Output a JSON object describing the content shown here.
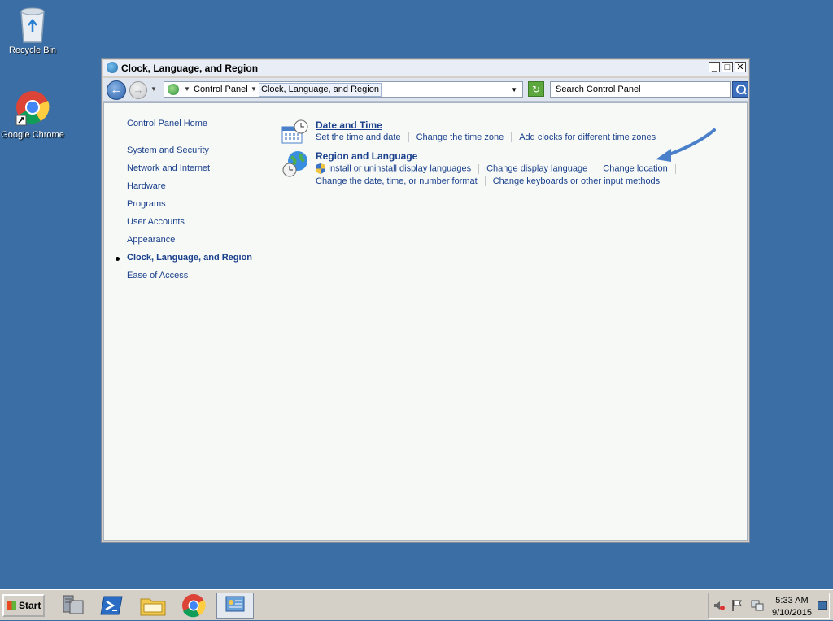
{
  "desktop": {
    "icons": [
      {
        "label": "Recycle Bin"
      },
      {
        "label": "Google Chrome"
      }
    ]
  },
  "window": {
    "title": "Clock, Language, and Region",
    "controls": {
      "minimize": "_",
      "maximize": "□",
      "close": "✕"
    },
    "address": {
      "crumbs": [
        "Control Panel",
        "Clock, Language, and Region"
      ]
    },
    "search": {
      "placeholder": "Search Control Panel"
    }
  },
  "left_nav": {
    "home": "Control Panel Home",
    "items": [
      "System and Security",
      "Network and Internet",
      "Hardware",
      "Programs",
      "User Accounts",
      "Appearance",
      "Clock, Language, and Region",
      "Ease of Access"
    ],
    "selected": "Clock, Language, and Region"
  },
  "categories": [
    {
      "title": "Date and Time",
      "links": [
        "Set the time and date",
        "Change the time zone",
        "Add clocks for different time zones"
      ]
    },
    {
      "title": "Region and Language",
      "links_row1": [
        "Install or uninstall display languages",
        "Change display language",
        "Change location"
      ],
      "links_row2": [
        "Change the date, time, or number format",
        "Change keyboards or other input methods"
      ]
    }
  ],
  "taskbar": {
    "start_label": "Start",
    "clock": {
      "time": "5:33 AM",
      "date": "9/10/2015"
    }
  },
  "colors": {
    "desktop": "#3a6ea5",
    "link": "#1a3f8c",
    "annotation_arrow": "#4a7fc9"
  }
}
